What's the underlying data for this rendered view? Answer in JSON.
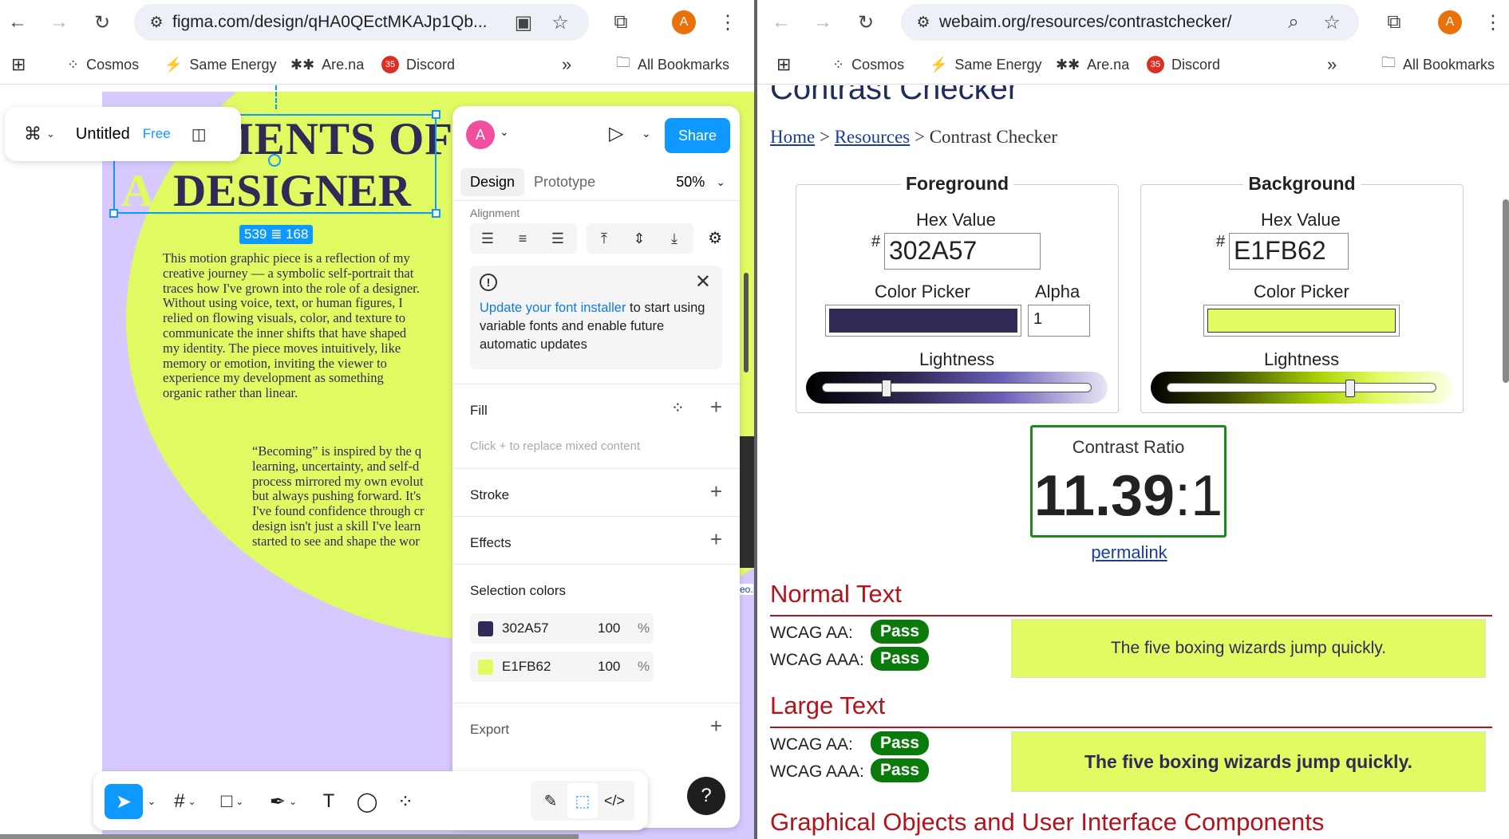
{
  "left_browser": {
    "url": "figma.com/design/qHA0QEctMKAJp1Qb...",
    "bookmarks": [
      "Cosmos",
      "Same Energy",
      "Are.na",
      "Discord"
    ],
    "discord_badge": "35",
    "all_bookmarks": "All Bookmarks",
    "profile_initial": "A"
  },
  "right_browser": {
    "url": "webaim.org/resources/contrastchecker/",
    "bookmarks": [
      "Cosmos",
      "Same Energy",
      "Are.na",
      "Discord"
    ],
    "discord_badge": "35",
    "all_bookmarks": "All Bookmarks",
    "profile_initial": "A"
  },
  "figma": {
    "file_name": "Untitled",
    "plan_badge": "Free",
    "canvas": {
      "title_line1": "MENTS OF",
      "title_line2_a": "A",
      "title_line2_b": "DESIGNER",
      "selection_size": "539 ≣ 168",
      "paragraph1": "This motion graphic piece is a reflection of my creative journey — a symbolic self-portrait that traces how I've grown into the role of a designer. Without using voice, text, or human figures, I relied on flowing visuals, color, and texture to communicate the inner shifts that have shaped my identity. The piece moves intuitively, like memory or emotion, inviting the viewer to experience my development as something organic rather than linear.",
      "paragraph2_lines": [
        "“Becoming” is inspired by the q",
        "learning, uncertainty, and self-d",
        "process mirrored my own evolut",
        "but always pushing forward. It's",
        "I've found confidence through cr",
        "design isn't just a skill I've learn",
        "started to see and shape the wor"
      ],
      "sliver_text": [
        "eo.",
        "re"
      ]
    },
    "panel": {
      "avatar_initial": "A",
      "share_label": "Share",
      "tab_design": "Design",
      "tab_prototype": "Prototype",
      "zoom": "50%",
      "alignment_label": "Alignment",
      "banner_link": "Update your font installer",
      "banner_text": " to start using variable fonts and enable future automatic updates",
      "fill_label": "Fill",
      "fill_hint": "Click + to replace mixed content",
      "stroke_label": "Stroke",
      "effects_label": "Effects",
      "selection_colors_label": "Selection colors",
      "selection_colors": [
        {
          "hex": "302A57",
          "opacity": "100",
          "unit": "%",
          "color": "#302a57"
        },
        {
          "hex": "E1FB62",
          "opacity": "100",
          "unit": "%",
          "color": "#e1fb62"
        }
      ],
      "export_label": "Export"
    },
    "help_label": "?"
  },
  "webaim": {
    "page_title": "Contrast Checker",
    "breadcrumb": {
      "home": "Home",
      "sep": ">",
      "resources": "Resources",
      "current": "Contrast Checker"
    },
    "foreground": {
      "legend": "Foreground",
      "hex_label": "Hex Value",
      "hash": "#",
      "hex_value": "302A57",
      "color_picker_label": "Color Picker",
      "alpha_label": "Alpha",
      "alpha_value": "1",
      "lightness_label": "Lightness",
      "lightness_level": 0.24,
      "color": "#302a57"
    },
    "background": {
      "legend": "Background",
      "hex_label": "Hex Value",
      "hash": "#",
      "hex_value": "E1FB62",
      "color_picker_label": "Color Picker",
      "lightness_label": "Lightness",
      "lightness_level": 0.68,
      "color": "#e1fb62"
    },
    "contrast": {
      "label": "Contrast Ratio",
      "value": "11.39",
      "suffix": ":1"
    },
    "permalink": "permalink",
    "normal_text": {
      "heading": "Normal Text",
      "aa_label": "WCAG AA:",
      "aa_result": "Pass",
      "aaa_label": "WCAG AAA:",
      "aaa_result": "Pass",
      "sample": "The five boxing wizards jump quickly."
    },
    "large_text": {
      "heading": "Large Text",
      "aa_label": "WCAG AA:",
      "aa_result": "Pass",
      "aaa_label": "WCAG AAA:",
      "aaa_result": "Pass",
      "sample": "The five boxing wizards jump quickly."
    },
    "graphical_heading": "Graphical Objects and User Interface Components"
  }
}
